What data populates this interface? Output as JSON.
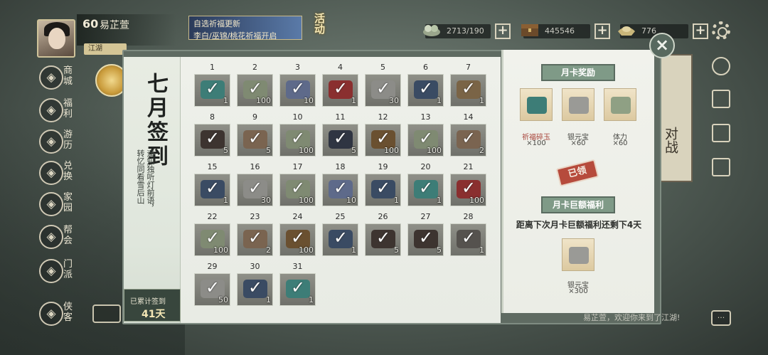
{
  "player": {
    "level": "60",
    "name": "易芷萱",
    "sect_tag": "江湖"
  },
  "event_banner": {
    "line1": "自选祈福更新",
    "line2": "李白/巫锦/桃花祈福开启",
    "label": "活动"
  },
  "resources": [
    {
      "icon": "jade-icon",
      "value": "2713/190"
    },
    {
      "icon": "treasure-chest-icon",
      "value": "445546"
    },
    {
      "icon": "silver-ingot-icon",
      "value": "776"
    }
  ],
  "left_menu": [
    {
      "label": "商城",
      "icon": "shop-icon"
    },
    {
      "label": "福利",
      "icon": "welfare-icon"
    },
    {
      "label": "游历",
      "icon": "travel-icon"
    },
    {
      "label": "兑换",
      "icon": "exchange-icon"
    },
    {
      "label": "家园",
      "icon": "home-icon"
    },
    {
      "label": "帮会",
      "icon": "guild-icon"
    },
    {
      "label": "门派",
      "icon": "sect-icon"
    },
    {
      "label": "侠客",
      "icon": "hero-icon"
    }
  ],
  "background_banner": "对战",
  "signin": {
    "title": "七月签到",
    "poem_lines": [
      "遥知独听灯前语，",
      "转忆同看雪后山"
    ],
    "total_label": "已累计签到",
    "total_value": "41天",
    "days": [
      {
        "day": "1",
        "qty": "1",
        "color": "#3d7d77"
      },
      {
        "day": "2",
        "qty": "100",
        "color": "#7f8a72"
      },
      {
        "day": "3",
        "qty": "10",
        "color": "#5e6a8a"
      },
      {
        "day": "4",
        "qty": "1",
        "color": "#8a2f2f"
      },
      {
        "day": "5",
        "qty": "30",
        "color": "#8c8c88"
      },
      {
        "day": "6",
        "qty": "1",
        "color": "#3a4b63"
      },
      {
        "day": "7",
        "qty": "1",
        "color": "#7a6446"
      },
      {
        "day": "8",
        "qty": "5",
        "color": "#3d3430"
      },
      {
        "day": "9",
        "qty": "5",
        "color": "#7a6450"
      },
      {
        "day": "10",
        "qty": "100",
        "color": "#7f8a72"
      },
      {
        "day": "11",
        "qty": "5",
        "color": "#2f3542"
      },
      {
        "day": "12",
        "qty": "100",
        "color": "#6a5030"
      },
      {
        "day": "13",
        "qty": "100",
        "color": "#7f8a72"
      },
      {
        "day": "14",
        "qty": "2",
        "color": "#7a6450"
      },
      {
        "day": "15",
        "qty": "1",
        "color": "#3a4b63"
      },
      {
        "day": "16",
        "qty": "30",
        "color": "#8c8c88"
      },
      {
        "day": "17",
        "qty": "100",
        "color": "#7f8a72"
      },
      {
        "day": "18",
        "qty": "10",
        "color": "#5e6a8a"
      },
      {
        "day": "19",
        "qty": "1",
        "color": "#3a4b63"
      },
      {
        "day": "20",
        "qty": "1",
        "color": "#3d7d77"
      },
      {
        "day": "21",
        "qty": "100",
        "color": "#8a2f2f"
      },
      {
        "day": "22",
        "qty": "100",
        "color": "#7f8a72"
      },
      {
        "day": "23",
        "qty": "2",
        "color": "#7a6450"
      },
      {
        "day": "24",
        "qty": "100",
        "color": "#6a5030"
      },
      {
        "day": "25",
        "qty": "1",
        "color": "#3a4b63"
      },
      {
        "day": "26",
        "qty": "5",
        "color": "#3d3430"
      },
      {
        "day": "27",
        "qty": "5",
        "color": "#3d3430"
      },
      {
        "day": "28",
        "qty": "1",
        "color": "#55524e"
      },
      {
        "day": "29",
        "qty": "50",
        "color": "#8c8c88"
      },
      {
        "day": "30",
        "qty": "1",
        "color": "#3a4b63"
      },
      {
        "day": "31",
        "qty": "1",
        "color": "#3d7d77"
      }
    ]
  },
  "monthly_card": {
    "reward_title": "月卡奖励",
    "rewards": [
      {
        "name": "祈福碎玉",
        "qty": "×100",
        "color": "#3d7d77",
        "highlight": true
      },
      {
        "name": "银元宝",
        "qty": "×60",
        "color": "#9a9a96",
        "highlight": false
      },
      {
        "name": "体力",
        "qty": "×60",
        "color": "#8fa084",
        "highlight": false
      }
    ],
    "claimed_stamp": "已领",
    "big_title": "月卡巨额福利",
    "countdown": "距离下次月卡巨额福利还剩下4天",
    "big_reward": {
      "name": "银元宝",
      "qty": "×300",
      "color": "#9a9a96"
    }
  },
  "chat": {
    "tip": "易芷萱，欢迎你来到了江湖!"
  }
}
